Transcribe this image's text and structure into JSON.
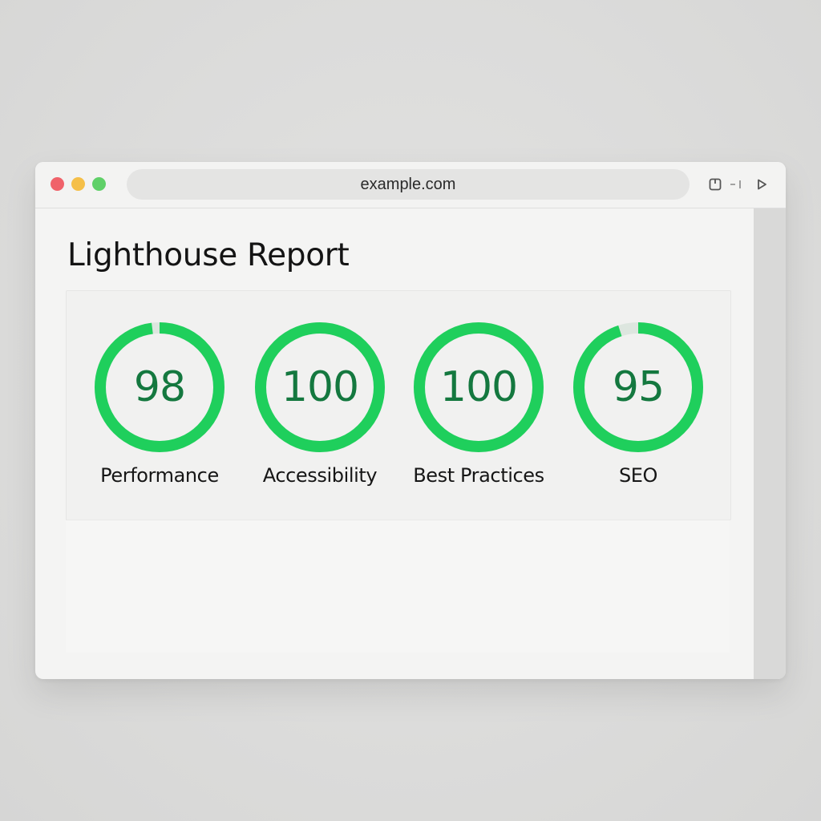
{
  "browser": {
    "url": "example.com"
  },
  "page": {
    "title": "Lighthouse Report"
  },
  "colors": {
    "gauge_fill": "#1fcf5c",
    "gauge_track": "#dde6df",
    "score_text": "#14783f"
  },
  "scores": [
    {
      "label": "Performance",
      "value": "98",
      "fraction": 0.98
    },
    {
      "label": "Accessibility",
      "value": "100",
      "fraction": 1.0
    },
    {
      "label": "Best Practices",
      "value": "100",
      "fraction": 1.0
    },
    {
      "label": "SEO",
      "value": "95",
      "fraction": 0.95
    }
  ]
}
